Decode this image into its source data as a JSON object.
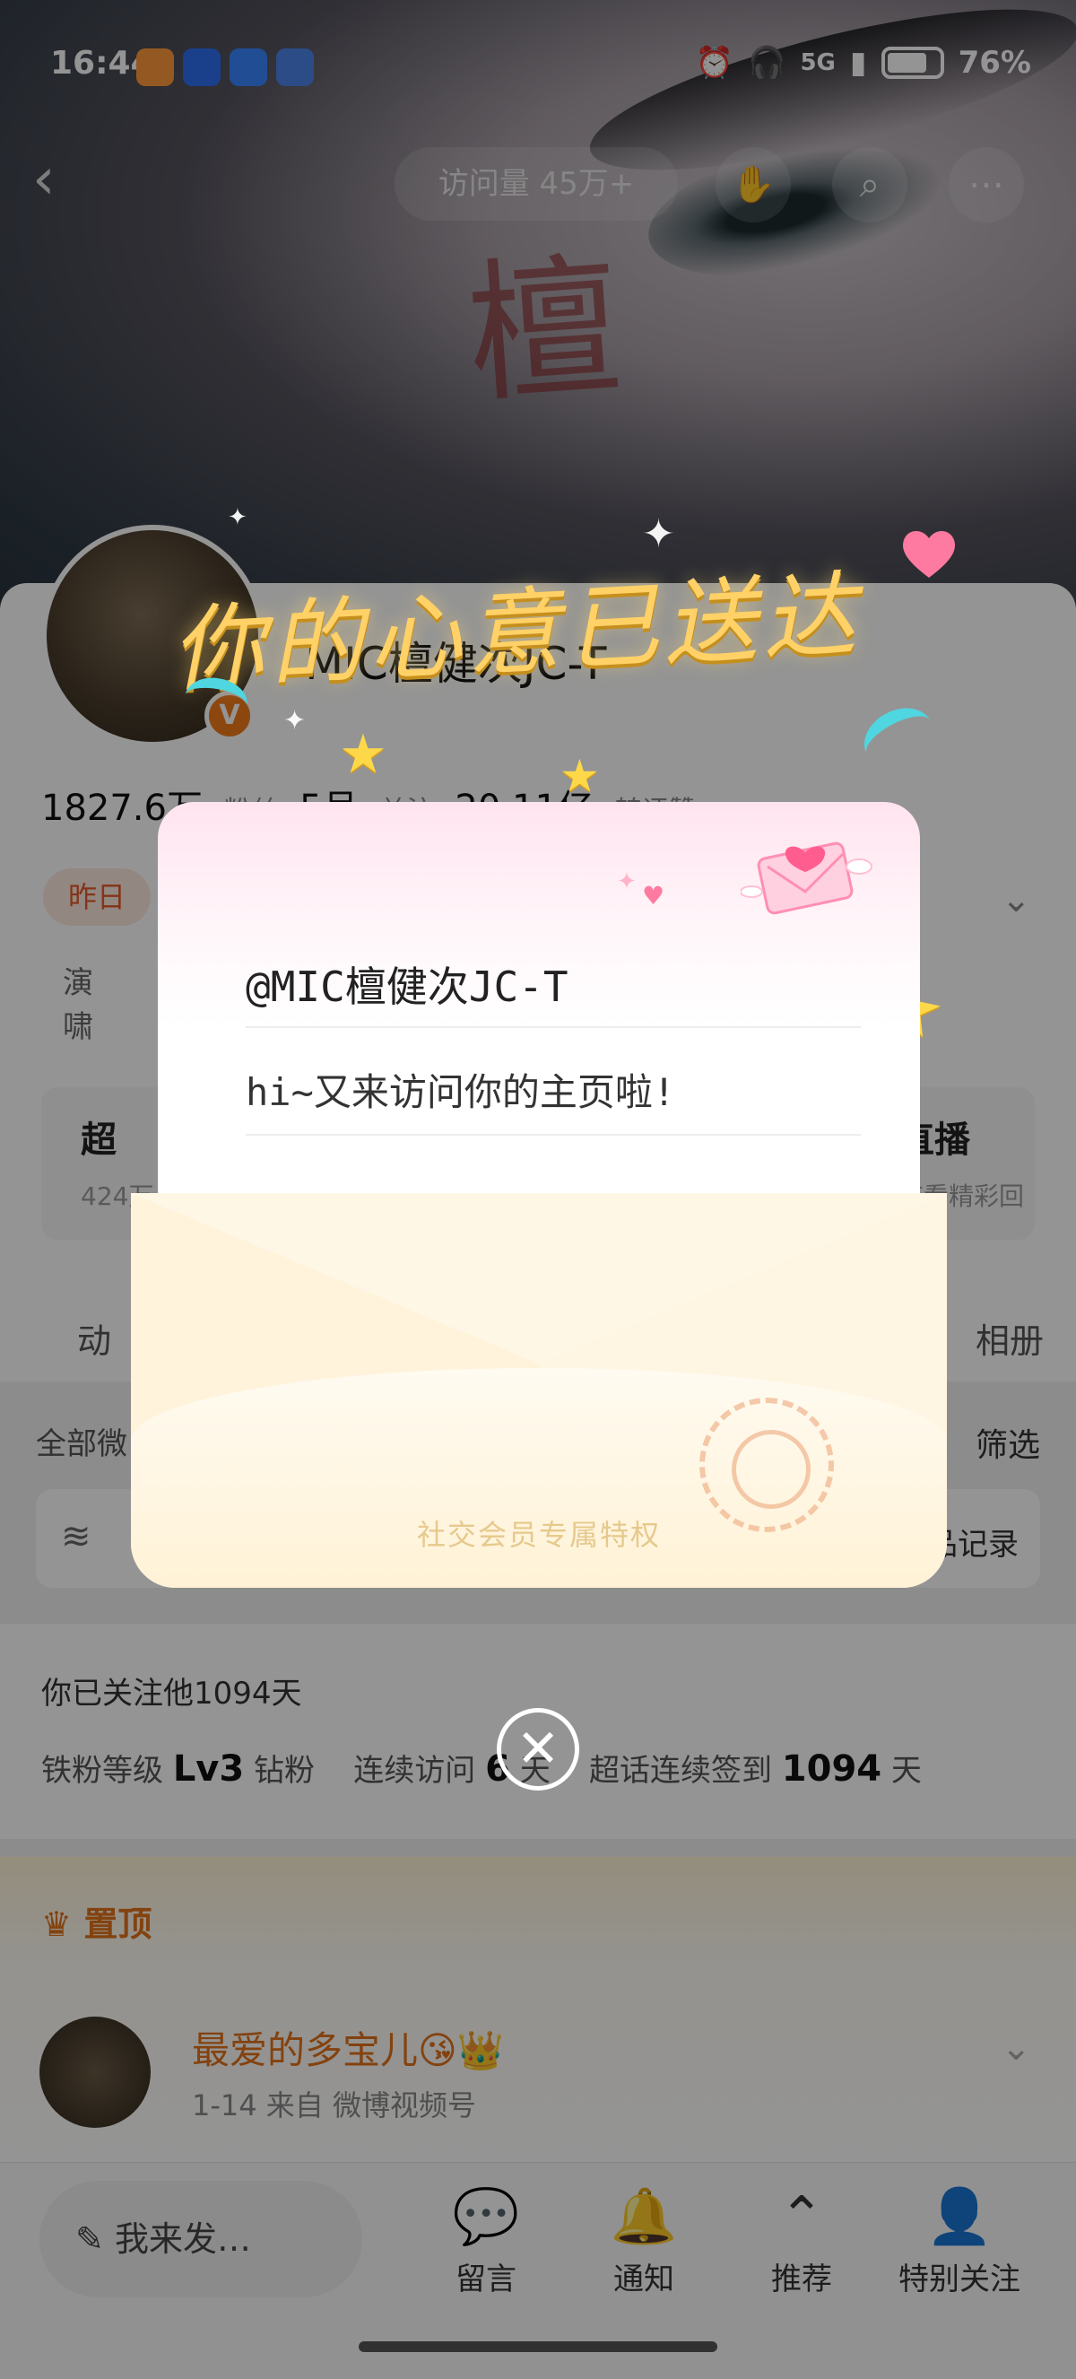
{
  "status_bar": {
    "time": "16:44",
    "network": "5G",
    "battery": "76%",
    "battery_level": 0.76,
    "app_icon_colors": [
      "#ff9a3c",
      "#2f6ff0",
      "#3a86ff",
      "#4a84e8"
    ]
  },
  "nav": {
    "back_icon": "chevron-left-icon",
    "visits": "访问量 45万+",
    "buttons": [
      "hand-icon",
      "search-icon",
      "more-icon"
    ]
  },
  "profile": {
    "username": "MIC檀健次JC-T",
    "stats": [
      {
        "value": "1827.6万",
        "label": "粉丝"
      },
      {
        "value": "5月",
        "label": "关注"
      },
      {
        "value": "20.11亿",
        "label": "转评赞"
      }
    ],
    "tag": "昨日",
    "description": "演\n啸",
    "cards": [
      {
        "title": "超",
        "sub": "424万"
      },
      {
        "title": "直播",
        "sub": "查看精彩回"
      }
    ],
    "tabs": [
      "动",
      "相册"
    ]
  },
  "feed": {
    "all_label": "全部微",
    "filter_label": "筛选",
    "works_label": "作品记录",
    "follow_days_text": "你已关注他1094天",
    "fan_level_label": "铁粉等级",
    "fan_level_value": "Lv3",
    "fan_level_suffix": "钻粉",
    "visit_label": "连续访问",
    "visit_value": "6",
    "visit_suffix": "天",
    "checkin_label": "超话连续签到",
    "checkin_value": "1094",
    "checkin_suffix": "天"
  },
  "pinned": {
    "header": "置顶",
    "name": "最爱的多宝儿😘👑",
    "meta": "1-14 来自 微博视频号"
  },
  "bottom_bar": {
    "compose": "我来发…",
    "items": [
      {
        "icon": "comment-icon",
        "label": "留言"
      },
      {
        "icon": "bell-icon",
        "label": "通知"
      },
      {
        "icon": "chevron-up-circle-icon",
        "label": "推荐"
      },
      {
        "icon": "special-follow-icon",
        "label": "特别关注"
      }
    ]
  },
  "modal": {
    "title": "你的心意已送达",
    "to": "@MIC檀健次JC-T",
    "message": "hi~又来访问你的主页啦!",
    "privilege": "社交会员专属特权",
    "close_icon": "close-circle-icon"
  }
}
